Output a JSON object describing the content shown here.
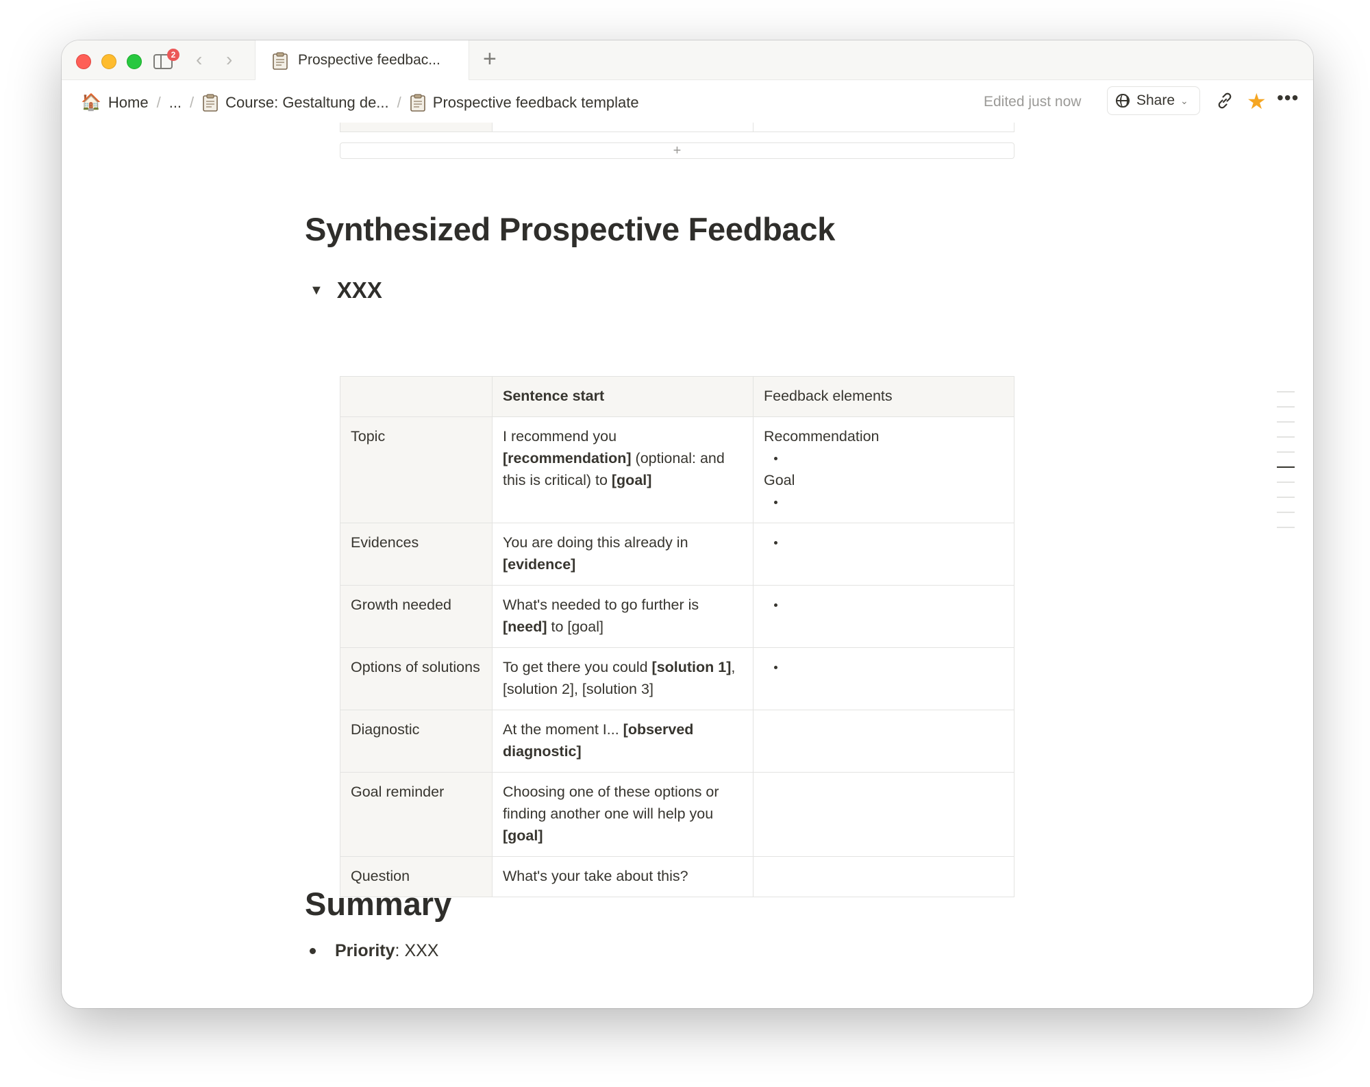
{
  "tabbar": {
    "badge_count": "2",
    "tab_title": "Prospective feedbac...",
    "new_tab": "+"
  },
  "breadcrumb": {
    "home": "Home",
    "ellipsis": "...",
    "course": "Course: Gestaltung de...",
    "page": "Prospective feedback template",
    "separator": "/"
  },
  "topbar": {
    "edited": "Edited just now",
    "share_label": "Share"
  },
  "content": {
    "add_row": "+",
    "heading": "Synthesized Prospective Feedback",
    "toggle_title": "XXX",
    "table": {
      "headers": [
        "",
        "Sentence start",
        "Feedback elements"
      ],
      "rows": [
        {
          "label": "Topic",
          "sentence": [
            [
              "I recommend you ",
              false
            ],
            [
              "[recommendation]",
              true
            ],
            [
              " (optional: and this is critical) to ",
              false
            ],
            [
              "[goal]",
              true
            ]
          ],
          "elements": [
            "Recommendation",
            "•",
            "Goal",
            "•"
          ]
        },
        {
          "label": "Evidences",
          "sentence": [
            [
              "You are doing this already in ",
              false
            ],
            [
              "[evidence]",
              true
            ]
          ],
          "elements": [
            "•"
          ]
        },
        {
          "label": "Growth needed",
          "sentence": [
            [
              "What's needed to go further is ",
              false
            ],
            [
              "[need]",
              true
            ],
            [
              " to [goal]",
              false
            ]
          ],
          "elements": [
            "•"
          ]
        },
        {
          "label": "Options of solutions",
          "sentence": [
            [
              "To get there you could ",
              false
            ],
            [
              "[solution 1]",
              true
            ],
            [
              ", [solution 2], [solution 3]",
              false
            ]
          ],
          "elements": [
            "•"
          ]
        },
        {
          "label": "Diagnostic",
          "sentence": [
            [
              "At the moment I... ",
              false
            ],
            [
              "[observed diagnostic]",
              true
            ]
          ],
          "elements": []
        },
        {
          "label": "Goal reminder",
          "sentence": [
            [
              "Choosing one of these options or finding another one will help you ",
              false
            ],
            [
              "[goal]",
              true
            ]
          ],
          "elements": []
        },
        {
          "label": "Question",
          "sentence": [
            [
              "What's your take about this?",
              false
            ]
          ],
          "elements": []
        }
      ]
    },
    "summary_heading": "Summary",
    "summary_item_label": "Priority",
    "summary_item_sep": ": ",
    "summary_item_value": "XXX"
  },
  "icons": {
    "tab": "doc-icon",
    "home": "house-icon",
    "share": "globe-icon",
    "link": "link-icon",
    "favorite": "star-icon",
    "more": "more-icon",
    "help": "help-icon"
  },
  "colors": {
    "accent_star": "#f5a623",
    "badge": "#eb5757",
    "text": "#37352f",
    "header_bg": "#f7f6f3"
  }
}
